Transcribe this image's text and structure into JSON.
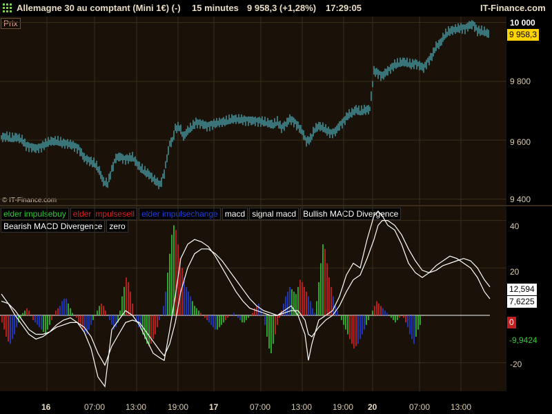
{
  "header": {
    "instrument": "Allemagne 30 au comptant (Mini 1€) (-)",
    "timeframe": "15 minutes",
    "quote": "9 958,3 (+1,28%)",
    "time": "17:29:05",
    "brand": "IT-Finance.com"
  },
  "price_panel": {
    "label": "Prix",
    "copyright": "© IT-Finance.com",
    "current_price_tag": "9 958,3",
    "y_ticks": [
      "10 000",
      "9 800",
      "9 600",
      "9 400"
    ],
    "colors": {
      "bars": "#4fb6c2",
      "grid": "#3a2c1a",
      "background": "#1a1209",
      "tag": "#ffd400"
    }
  },
  "indicator_panel": {
    "legend_row1": [
      {
        "label": "elder impulsebuy",
        "color": "#2ecc2e"
      },
      {
        "label": "elder impulsesell",
        "color": "#e02020"
      },
      {
        "label": "elder impulsechange",
        "color": "#2040e0"
      },
      {
        "label": "macd",
        "color": "#ffffff"
      },
      {
        "label": "signal macd",
        "color": "#ffffff"
      },
      {
        "label": "Bullish MACD Divergence",
        "color": "#ffffff"
      }
    ],
    "legend_row2": [
      {
        "label": "Bearish MACD Divergence",
        "color": "#ffffff"
      },
      {
        "label": "zero",
        "color": "#ffffff"
      }
    ],
    "y_ticks": [
      "40",
      "20",
      "-20"
    ],
    "value_tags": [
      {
        "text": "12,594",
        "bg": "#ffffff",
        "fg": "#000000"
      },
      {
        "text": "7,6225",
        "bg": "#ffffff",
        "fg": "#000000"
      },
      {
        "text": "0",
        "bg": "#c02020",
        "fg": "#ffffff"
      },
      {
        "text": "-9,9424",
        "bg": "#000000",
        "fg": "#2ecc2e"
      }
    ]
  },
  "x_axis": {
    "labels": [
      {
        "text": "16",
        "day": true
      },
      {
        "text": "07:00",
        "day": false
      },
      {
        "text": "13:00",
        "day": false
      },
      {
        "text": "19:00",
        "day": false
      },
      {
        "text": "17",
        "day": true
      },
      {
        "text": "07:00",
        "day": false
      },
      {
        "text": "13:00",
        "day": false
      },
      {
        "text": "19:00",
        "day": false
      },
      {
        "text": "20",
        "day": true
      },
      {
        "text": "07:00",
        "day": false
      },
      {
        "text": "13:00",
        "day": false
      }
    ]
  },
  "chart_data": {
    "type": "line",
    "title": "Allemagne 30 au comptant (Mini 1€) (-)",
    "price_series": {
      "name": "Prix",
      "points": [
        [
          0,
          9610
        ],
        [
          8,
          9612
        ],
        [
          14,
          9605
        ],
        [
          22,
          9610
        ],
        [
          30,
          9600
        ],
        [
          36,
          9582
        ],
        [
          42,
          9578
        ],
        [
          50,
          9572
        ],
        [
          58,
          9578
        ],
        [
          66,
          9590
        ],
        [
          72,
          9596
        ],
        [
          80,
          9596
        ],
        [
          88,
          9590
        ],
        [
          96,
          9588
        ],
        [
          104,
          9582
        ],
        [
          112,
          9572
        ],
        [
          120,
          9540
        ],
        [
          128,
          9530
        ],
        [
          136,
          9518
        ],
        [
          142,
          9495
        ],
        [
          148,
          9458
        ],
        [
          154,
          9452
        ],
        [
          160,
          9500
        ],
        [
          166,
          9540
        ],
        [
          172,
          9544
        ],
        [
          178,
          9536
        ],
        [
          184,
          9538
        ],
        [
          190,
          9542
        ],
        [
          196,
          9522
        ],
        [
          202,
          9504
        ],
        [
          208,
          9492
        ],
        [
          214,
          9484
        ],
        [
          220,
          9468
        ],
        [
          226,
          9456
        ],
        [
          230,
          9448
        ],
        [
          236,
          9488
        ],
        [
          240,
          9540
        ],
        [
          244,
          9588
        ],
        [
          248,
          9600
        ],
        [
          252,
          9640
        ],
        [
          258,
          9644
        ],
        [
          264,
          9612
        ],
        [
          270,
          9632
        ],
        [
          276,
          9644
        ],
        [
          282,
          9660
        ],
        [
          290,
          9656
        ],
        [
          298,
          9648
        ],
        [
          306,
          9654
        ],
        [
          316,
          9660
        ],
        [
          326,
          9664
        ],
        [
          336,
          9672
        ],
        [
          346,
          9670
        ],
        [
          356,
          9668
        ],
        [
          366,
          9666
        ],
        [
          376,
          9664
        ],
        [
          386,
          9658
        ],
        [
          394,
          9652
        ],
        [
          400,
          9662
        ],
        [
          406,
          9642
        ],
        [
          412,
          9654
        ],
        [
          418,
          9672
        ],
        [
          424,
          9664
        ],
        [
          430,
          9648
        ],
        [
          436,
          9628
        ],
        [
          442,
          9596
        ],
        [
          448,
          9604
        ],
        [
          454,
          9636
        ],
        [
          460,
          9648
        ],
        [
          466,
          9642
        ],
        [
          472,
          9632
        ],
        [
          478,
          9624
        ],
        [
          484,
          9630
        ],
        [
          490,
          9650
        ],
        [
          496,
          9664
        ],
        [
          502,
          9684
        ],
        [
          508,
          9692
        ],
        [
          514,
          9704
        ],
        [
          520,
          9696
        ],
        [
          526,
          9702
        ],
        [
          534,
          9706
        ],
        [
          540,
          9835
        ],
        [
          546,
          9828
        ],
        [
          552,
          9818
        ],
        [
          558,
          9832
        ],
        [
          564,
          9844
        ],
        [
          570,
          9856
        ],
        [
          576,
          9860
        ],
        [
          582,
          9866
        ],
        [
          588,
          9862
        ],
        [
          594,
          9856
        ],
        [
          600,
          9862
        ],
        [
          606,
          9854
        ],
        [
          612,
          9846
        ],
        [
          618,
          9868
        ],
        [
          624,
          9886
        ],
        [
          630,
          9918
        ],
        [
          636,
          9930
        ],
        [
          642,
          9954
        ],
        [
          648,
          9968
        ],
        [
          654,
          9974
        ],
        [
          660,
          9978
        ],
        [
          666,
          9982
        ],
        [
          672,
          9980
        ],
        [
          678,
          9990
        ],
        [
          684,
          9994
        ],
        [
          690,
          9972
        ],
        [
          696,
          9970
        ],
        [
          702,
          9966
        ],
        [
          708,
          9958
        ]
      ]
    },
    "macd": {
      "x": [
        0,
        10,
        20,
        30,
        40,
        50,
        60,
        70,
        80,
        90,
        100,
        110,
        120,
        130,
        140,
        150,
        160,
        170,
        180,
        190,
        200,
        210,
        220,
        230,
        236,
        244,
        252,
        260,
        270,
        280,
        290,
        300,
        310,
        320,
        330,
        340,
        350,
        360,
        370,
        380,
        390,
        400,
        410,
        420,
        430,
        440,
        445,
        450,
        460,
        470,
        480,
        490,
        500,
        510,
        520,
        530,
        540,
        546,
        552,
        560,
        570,
        580,
        590,
        600,
        610,
        620,
        630,
        640,
        650,
        660,
        670,
        680,
        690,
        700,
        708
      ],
      "macd": [
        9,
        5,
        0,
        -4,
        -8,
        -10,
        -9,
        -7,
        -4,
        -2,
        -1,
        -3,
        -7,
        -14,
        -26,
        -30,
        -6,
        -2,
        2,
        0,
        -4,
        -10,
        -16,
        -18,
        -19,
        -6,
        8,
        24,
        30,
        32,
        31,
        29,
        25,
        20,
        15,
        10,
        6,
        3,
        2,
        1,
        0,
        0,
        2,
        4,
        0,
        -8,
        -19,
        -12,
        -2,
        0,
        2,
        8,
        17,
        22,
        20,
        32,
        42,
        44,
        42,
        38,
        36,
        30,
        22,
        18,
        16,
        18,
        21,
        23,
        25,
        24,
        22,
        20,
        16,
        10,
        7
      ],
      "signal": [
        6,
        5,
        2,
        -2,
        -6,
        -8,
        -8,
        -7,
        -5,
        -4,
        -3,
        -3,
        -5,
        -9,
        -16,
        -21,
        -13,
        -8,
        -3,
        -2,
        -3,
        -7,
        -11,
        -15,
        -17,
        -12,
        -3,
        10,
        20,
        26,
        28,
        28,
        26,
        23,
        19,
        15,
        11,
        7,
        4,
        2,
        1,
        0,
        1,
        2,
        2,
        -2,
        -8,
        -9,
        -5,
        -2,
        0,
        4,
        10,
        15,
        17,
        24,
        32,
        38,
        40,
        40,
        38,
        34,
        28,
        23,
        19,
        18,
        19,
        21,
        22,
        23,
        24,
        23,
        20,
        15,
        12
      ]
    },
    "histogram": {
      "x_start": 0,
      "x_step": 3,
      "values": [
        -3,
        -6,
        -9,
        -11,
        -12,
        -10,
        -8,
        -5,
        -3,
        -1,
        1,
        2,
        3,
        2,
        0,
        -2,
        -3,
        -4,
        -5,
        -6,
        -7,
        -8,
        -6,
        -4,
        -2,
        0,
        2,
        3,
        4,
        6,
        7,
        7,
        5,
        3,
        1,
        0,
        -1,
        -3,
        -5,
        -6,
        -7,
        -8,
        -6,
        -4,
        -2,
        0,
        2,
        4,
        5,
        4,
        2,
        0,
        -2,
        -4,
        -6,
        -5,
        -3,
        2,
        8,
        12,
        16,
        14,
        10,
        5,
        0,
        -3,
        -5,
        -6,
        -8,
        -10,
        -12,
        -13,
        -12,
        -10,
        -8,
        -5,
        -2,
        0,
        4,
        10,
        18,
        26,
        34,
        38,
        36,
        30,
        24,
        20,
        16,
        12,
        10,
        8,
        6,
        4,
        3,
        2,
        1,
        0,
        -1,
        -2,
        -3,
        -4,
        -5,
        -6,
        -6,
        -5,
        -4,
        -3,
        -2,
        -1,
        0,
        0,
        1,
        0,
        -1,
        -2,
        -3,
        -3,
        -2,
        -1,
        0,
        1,
        3,
        4,
        5,
        3,
        0,
        -4,
        -9,
        -14,
        -16,
        -12,
        -8,
        -4,
        -1,
        2,
        5,
        8,
        10,
        12,
        11,
        10,
        9,
        12,
        15,
        14,
        12,
        10,
        8,
        6,
        3,
        1,
        6,
        14,
        22,
        30,
        28,
        22,
        16,
        12,
        8,
        4,
        2,
        0,
        -2,
        -4,
        -6,
        -8,
        -10,
        -12,
        -14,
        -13,
        -12,
        -10,
        -8,
        -6,
        -4,
        -2,
        0,
        2,
        4,
        6,
        5,
        4,
        3,
        2,
        1,
        0,
        -1,
        -2,
        -3,
        -2,
        -1,
        0,
        -1,
        -3,
        -5,
        -8,
        -10,
        -12,
        -9,
        -6,
        -4
      ],
      "colors_cycle": [
        "#e02020",
        "#2040e0",
        "#2ecc2e"
      ]
    },
    "ylim_price": [
      9380,
      10020
    ],
    "ylim_indicator": [
      -32,
      46
    ],
    "x_range": [
      0,
      734
    ]
  }
}
